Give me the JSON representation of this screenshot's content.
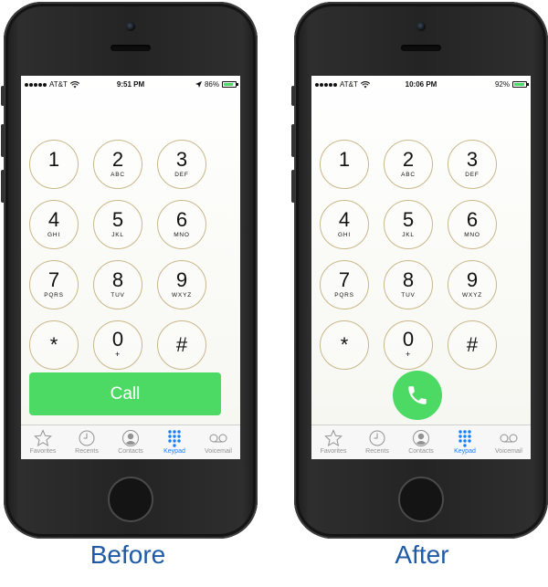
{
  "before": {
    "caption": "Before",
    "status": {
      "carrier": "AT&T",
      "time": "9:51 PM",
      "battery": "86%",
      "battery_level": 0.86
    },
    "call_label": "Call"
  },
  "after": {
    "caption": "After",
    "status": {
      "carrier": "AT&T",
      "time": "10:06 PM",
      "battery": "92%",
      "battery_level": 0.92
    }
  },
  "keys": [
    {
      "digit": "1",
      "letters": ""
    },
    {
      "digit": "2",
      "letters": "ABC"
    },
    {
      "digit": "3",
      "letters": "DEF"
    },
    {
      "digit": "4",
      "letters": "GHI"
    },
    {
      "digit": "5",
      "letters": "JKL"
    },
    {
      "digit": "6",
      "letters": "MNO"
    },
    {
      "digit": "7",
      "letters": "PQRS"
    },
    {
      "digit": "8",
      "letters": "TUV"
    },
    {
      "digit": "9",
      "letters": "WXYZ"
    },
    {
      "digit": "*",
      "letters": ""
    },
    {
      "digit": "0",
      "letters": "+"
    },
    {
      "digit": "#",
      "letters": ""
    }
  ],
  "tabs": [
    {
      "label": "Favorites",
      "icon": "star-icon"
    },
    {
      "label": "Recents",
      "icon": "clock-icon"
    },
    {
      "label": "Contacts",
      "icon": "contact-icon"
    },
    {
      "label": "Keypad",
      "icon": "keypad-icon",
      "active": true
    },
    {
      "label": "Voicemail",
      "icon": "voicemail-icon"
    }
  ],
  "colors": {
    "call_green": "#4cd964",
    "active_blue": "#157efb",
    "caption_blue": "#1f5aa6",
    "key_ring": "#c9b78a"
  }
}
